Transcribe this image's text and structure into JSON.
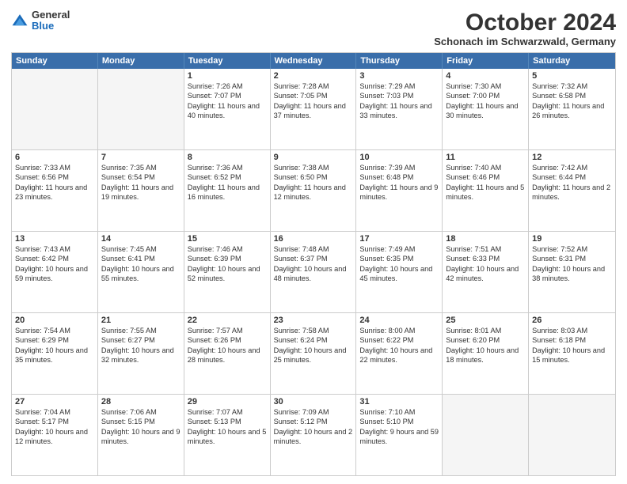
{
  "logo": {
    "general": "General",
    "blue": "Blue"
  },
  "header": {
    "month": "October 2024",
    "location": "Schonach im Schwarzwald, Germany"
  },
  "weekdays": [
    "Sunday",
    "Monday",
    "Tuesday",
    "Wednesday",
    "Thursday",
    "Friday",
    "Saturday"
  ],
  "rows": [
    [
      {
        "day": "",
        "text": ""
      },
      {
        "day": "",
        "text": ""
      },
      {
        "day": "1",
        "text": "Sunrise: 7:26 AM\nSunset: 7:07 PM\nDaylight: 11 hours and 40 minutes."
      },
      {
        "day": "2",
        "text": "Sunrise: 7:28 AM\nSunset: 7:05 PM\nDaylight: 11 hours and 37 minutes."
      },
      {
        "day": "3",
        "text": "Sunrise: 7:29 AM\nSunset: 7:03 PM\nDaylight: 11 hours and 33 minutes."
      },
      {
        "day": "4",
        "text": "Sunrise: 7:30 AM\nSunset: 7:00 PM\nDaylight: 11 hours and 30 minutes."
      },
      {
        "day": "5",
        "text": "Sunrise: 7:32 AM\nSunset: 6:58 PM\nDaylight: 11 hours and 26 minutes."
      }
    ],
    [
      {
        "day": "6",
        "text": "Sunrise: 7:33 AM\nSunset: 6:56 PM\nDaylight: 11 hours and 23 minutes."
      },
      {
        "day": "7",
        "text": "Sunrise: 7:35 AM\nSunset: 6:54 PM\nDaylight: 11 hours and 19 minutes."
      },
      {
        "day": "8",
        "text": "Sunrise: 7:36 AM\nSunset: 6:52 PM\nDaylight: 11 hours and 16 minutes."
      },
      {
        "day": "9",
        "text": "Sunrise: 7:38 AM\nSunset: 6:50 PM\nDaylight: 11 hours and 12 minutes."
      },
      {
        "day": "10",
        "text": "Sunrise: 7:39 AM\nSunset: 6:48 PM\nDaylight: 11 hours and 9 minutes."
      },
      {
        "day": "11",
        "text": "Sunrise: 7:40 AM\nSunset: 6:46 PM\nDaylight: 11 hours and 5 minutes."
      },
      {
        "day": "12",
        "text": "Sunrise: 7:42 AM\nSunset: 6:44 PM\nDaylight: 11 hours and 2 minutes."
      }
    ],
    [
      {
        "day": "13",
        "text": "Sunrise: 7:43 AM\nSunset: 6:42 PM\nDaylight: 10 hours and 59 minutes."
      },
      {
        "day": "14",
        "text": "Sunrise: 7:45 AM\nSunset: 6:41 PM\nDaylight: 10 hours and 55 minutes."
      },
      {
        "day": "15",
        "text": "Sunrise: 7:46 AM\nSunset: 6:39 PM\nDaylight: 10 hours and 52 minutes."
      },
      {
        "day": "16",
        "text": "Sunrise: 7:48 AM\nSunset: 6:37 PM\nDaylight: 10 hours and 48 minutes."
      },
      {
        "day": "17",
        "text": "Sunrise: 7:49 AM\nSunset: 6:35 PM\nDaylight: 10 hours and 45 minutes."
      },
      {
        "day": "18",
        "text": "Sunrise: 7:51 AM\nSunset: 6:33 PM\nDaylight: 10 hours and 42 minutes."
      },
      {
        "day": "19",
        "text": "Sunrise: 7:52 AM\nSunset: 6:31 PM\nDaylight: 10 hours and 38 minutes."
      }
    ],
    [
      {
        "day": "20",
        "text": "Sunrise: 7:54 AM\nSunset: 6:29 PM\nDaylight: 10 hours and 35 minutes."
      },
      {
        "day": "21",
        "text": "Sunrise: 7:55 AM\nSunset: 6:27 PM\nDaylight: 10 hours and 32 minutes."
      },
      {
        "day": "22",
        "text": "Sunrise: 7:57 AM\nSunset: 6:26 PM\nDaylight: 10 hours and 28 minutes."
      },
      {
        "day": "23",
        "text": "Sunrise: 7:58 AM\nSunset: 6:24 PM\nDaylight: 10 hours and 25 minutes."
      },
      {
        "day": "24",
        "text": "Sunrise: 8:00 AM\nSunset: 6:22 PM\nDaylight: 10 hours and 22 minutes."
      },
      {
        "day": "25",
        "text": "Sunrise: 8:01 AM\nSunset: 6:20 PM\nDaylight: 10 hours and 18 minutes."
      },
      {
        "day": "26",
        "text": "Sunrise: 8:03 AM\nSunset: 6:18 PM\nDaylight: 10 hours and 15 minutes."
      }
    ],
    [
      {
        "day": "27",
        "text": "Sunrise: 7:04 AM\nSunset: 5:17 PM\nDaylight: 10 hours and 12 minutes."
      },
      {
        "day": "28",
        "text": "Sunrise: 7:06 AM\nSunset: 5:15 PM\nDaylight: 10 hours and 9 minutes."
      },
      {
        "day": "29",
        "text": "Sunrise: 7:07 AM\nSunset: 5:13 PM\nDaylight: 10 hours and 5 minutes."
      },
      {
        "day": "30",
        "text": "Sunrise: 7:09 AM\nSunset: 5:12 PM\nDaylight: 10 hours and 2 minutes."
      },
      {
        "day": "31",
        "text": "Sunrise: 7:10 AM\nSunset: 5:10 PM\nDaylight: 9 hours and 59 minutes."
      },
      {
        "day": "",
        "text": ""
      },
      {
        "day": "",
        "text": ""
      }
    ]
  ]
}
